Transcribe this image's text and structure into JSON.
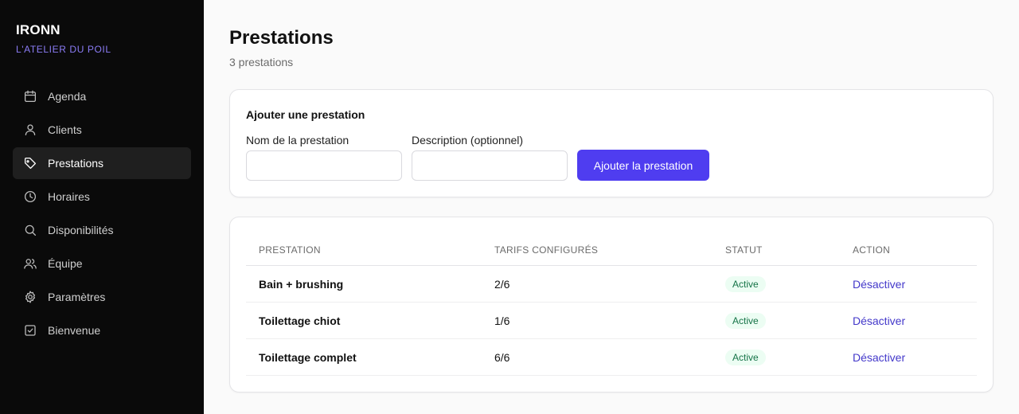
{
  "sidebar": {
    "brand": "IRONN",
    "subtitle": "L'ATELIER DU POIL",
    "items": [
      {
        "label": "Agenda",
        "icon": "calendar-icon"
      },
      {
        "label": "Clients",
        "icon": "user-icon"
      },
      {
        "label": "Prestations",
        "icon": "tag-icon",
        "active": true
      },
      {
        "label": "Horaires",
        "icon": "clock-icon"
      },
      {
        "label": "Disponibilités",
        "icon": "search-icon"
      },
      {
        "label": "Équipe",
        "icon": "users-icon"
      },
      {
        "label": "Paramètres",
        "icon": "gear-icon"
      },
      {
        "label": "Bienvenue",
        "icon": "checkbox-icon"
      }
    ]
  },
  "header": {
    "title": "Prestations",
    "count": "3 prestations"
  },
  "form": {
    "title": "Ajouter une prestation",
    "name_label": "Nom de la prestation",
    "name_value": "",
    "description_label": "Description (optionnel)",
    "description_value": "",
    "submit_label": "Ajouter la prestation"
  },
  "table": {
    "columns": [
      "PRESTATION",
      "TARIFS CONFIGURÉS",
      "STATUT",
      "ACTION"
    ],
    "rows": [
      {
        "name": "Bain + brushing",
        "tariffs": "2/6",
        "status": "Active",
        "action": "Désactiver"
      },
      {
        "name": "Toilettage chiot",
        "tariffs": "1/6",
        "status": "Active",
        "action": "Désactiver"
      },
      {
        "name": "Toilettage complet",
        "tariffs": "6/6",
        "status": "Active",
        "action": "Désactiver"
      }
    ]
  },
  "colors": {
    "sidebar_bg": "#0a0a0a",
    "accent": "#4f3df0",
    "brand_sub": "#8b7cf6",
    "status_bg": "#ecfdf3",
    "status_text": "#157347",
    "link": "#4338ca"
  }
}
